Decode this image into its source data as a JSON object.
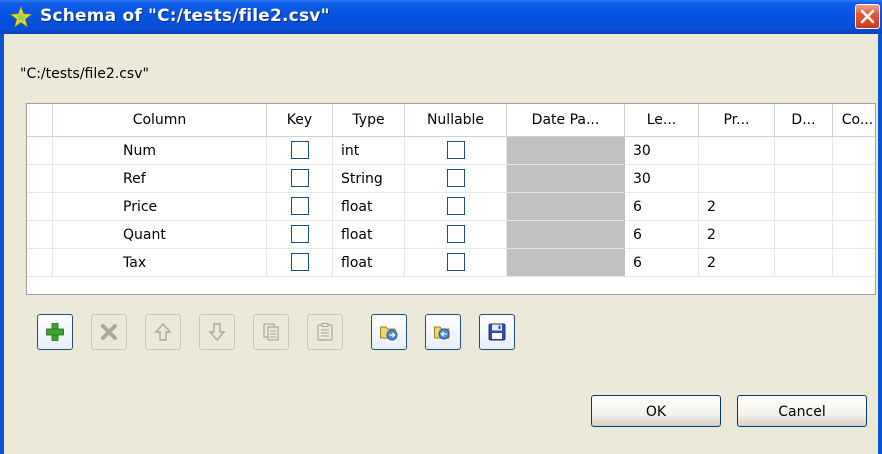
{
  "window": {
    "title": "Schema of \"C:/tests/file2.csv\""
  },
  "path_label": "\"C:/tests/file2.csv\"",
  "table": {
    "headers": [
      "Column",
      "Key",
      "Type",
      "Nullable",
      "Date Pa...",
      "Le...",
      "Pr...",
      "D...",
      "Co..."
    ],
    "rows": [
      {
        "column": "Num",
        "key": false,
        "type": "int",
        "nullable": false,
        "date_pattern": "",
        "length": "30",
        "precision": "",
        "default": "",
        "comment": ""
      },
      {
        "column": "Ref",
        "key": false,
        "type": "String",
        "nullable": false,
        "date_pattern": "",
        "length": "30",
        "precision": "",
        "default": "",
        "comment": ""
      },
      {
        "column": "Price",
        "key": false,
        "type": "float",
        "nullable": false,
        "date_pattern": "",
        "length": "6",
        "precision": "2",
        "default": "",
        "comment": ""
      },
      {
        "column": "Quant",
        "key": false,
        "type": "float",
        "nullable": false,
        "date_pattern": "",
        "length": "6",
        "precision": "2",
        "default": "",
        "comment": ""
      },
      {
        "column": "Tax",
        "key": false,
        "type": "float",
        "nullable": false,
        "date_pattern": "",
        "length": "6",
        "precision": "2",
        "default": "",
        "comment": ""
      }
    ]
  },
  "toolbar": [
    {
      "name": "add-button",
      "icon": "plus-icon",
      "enabled": true
    },
    {
      "name": "remove-button",
      "icon": "x-icon",
      "enabled": false
    },
    {
      "name": "move-up-button",
      "icon": "arrow-up-icon",
      "enabled": false
    },
    {
      "name": "move-down-button",
      "icon": "arrow-down-icon",
      "enabled": false
    },
    {
      "name": "copy-button",
      "icon": "copy-icon",
      "enabled": false
    },
    {
      "name": "paste-button",
      "icon": "paste-icon",
      "enabled": false
    },
    {
      "name": "import-button",
      "icon": "folder-import-icon",
      "enabled": true
    },
    {
      "name": "export-button",
      "icon": "folder-export-icon",
      "enabled": true
    },
    {
      "name": "save-button",
      "icon": "floppy-disk-icon",
      "enabled": true
    }
  ],
  "buttons": {
    "ok": "OK",
    "cancel": "Cancel"
  },
  "colors": {
    "titlebar": "#0553e0",
    "dialog_bg": "#ece9d8",
    "close_red": "#e05a3a",
    "disabled_cell": "#c0c0c0"
  }
}
